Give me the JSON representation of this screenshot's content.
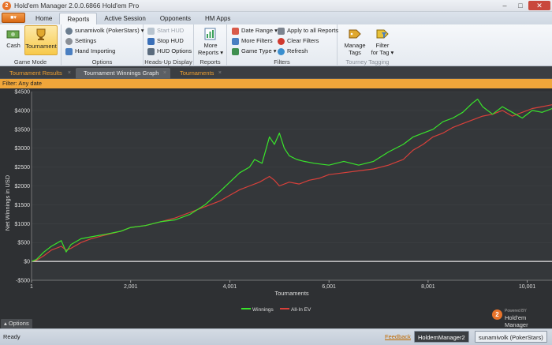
{
  "window": {
    "title": "Hold'em Manager 2.0.0.6866 Hold'em Pro",
    "app_button": "■▾"
  },
  "menu_tabs": [
    "Home",
    "Reports",
    "Active Session",
    "Opponents",
    "HM Apps"
  ],
  "active_menu_tab": "Reports",
  "ribbon": {
    "game_mode": {
      "label": "Game Mode",
      "cash": "Cash",
      "tournament": "Tournament"
    },
    "options": {
      "label": "Options",
      "player": "sunamivolk (PokerStars) ▾",
      "settings": "Settings",
      "hand_importing": "Hand Importing"
    },
    "hud": {
      "label": "Heads-Up Display",
      "start": "Start HUD",
      "stop": "Stop HUD",
      "options": "HUD Options"
    },
    "reports": {
      "label": "Reports",
      "more_line1": "More",
      "more_line2": "Reports ▾"
    },
    "filters": {
      "label": "Filters",
      "date_range": "Date Range ▾",
      "more_filters": "More Filters",
      "game_type": "Game Type ▾",
      "apply_all": "Apply to all Reports",
      "clear": "Clear Filters",
      "refresh": "Refresh"
    },
    "tourney": {
      "label": "Tourney Tagging",
      "manage_line1": "Manage",
      "manage_line2": "Tags",
      "filter_line1": "Filter",
      "filter_line2": "for Tag ▾"
    }
  },
  "doc_tabs": [
    {
      "label": "Tournament Results",
      "close": "×"
    },
    {
      "label": "Tournament Winnings Graph",
      "close": "×"
    },
    {
      "label": "Tournaments",
      "close": "×"
    }
  ],
  "active_doc_tab": "Tournament Winnings Graph",
  "filter_bar": {
    "text": "Filter:  Any date"
  },
  "options_button": "▴ Options",
  "brand": {
    "powered_by": "Powered BY",
    "name": "Hold'em Manager",
    "badge": "2"
  },
  "status": {
    "ready": "Ready",
    "feedback": "Feedback",
    "app": "HoldemManager2",
    "player": "sunamivolk (PokerStars)"
  },
  "colors": {
    "winnings": "#39e52b",
    "allin_ev": "#d9403a",
    "accent": "#f0a63a",
    "chart_bg": "#2e3033"
  },
  "chart_data": {
    "type": "line",
    "title": "",
    "xlabel": "Tournaments",
    "ylabel": "Net Winnings in USD",
    "xlim": [
      1,
      10500
    ],
    "ylim": [
      -500,
      4500
    ],
    "x_ticks": [
      1,
      2001,
      4001,
      6001,
      8001,
      10001
    ],
    "x_tick_labels": [
      "1",
      "2,001",
      "4,001",
      "6,001",
      "8,001",
      "10,001"
    ],
    "y_ticks": [
      -500,
      0,
      500,
      1000,
      1500,
      2000,
      2500,
      3000,
      3500,
      4000,
      4500
    ],
    "y_tick_labels": [
      "-$500",
      "$0",
      "$500",
      "$1000",
      "$1500",
      "$2000",
      "$2500",
      "$3000",
      "$3500",
      "$4000",
      "$4500"
    ],
    "legend_position": "bottom-center",
    "series": [
      {
        "name": "Winnings",
        "color": "#39e52b",
        "x": [
          1,
          100,
          250,
          400,
          600,
          700,
          800,
          1000,
          1200,
          1500,
          1800,
          2000,
          2300,
          2600,
          2900,
          3200,
          3500,
          3800,
          4000,
          4200,
          4400,
          4500,
          4650,
          4800,
          4900,
          5000,
          5100,
          5200,
          5350,
          5500,
          5700,
          6000,
          6300,
          6600,
          6900,
          7200,
          7500,
          7700,
          7900,
          8100,
          8300,
          8500,
          8700,
          8900,
          9000,
          9100,
          9300,
          9500,
          9700,
          9900,
          10100,
          10300,
          10500
        ],
        "y": [
          0,
          50,
          250,
          400,
          550,
          250,
          450,
          600,
          650,
          720,
          800,
          900,
          950,
          1050,
          1100,
          1250,
          1500,
          1850,
          2100,
          2350,
          2500,
          2700,
          2600,
          3300,
          3100,
          3400,
          3000,
          2800,
          2700,
          2650,
          2600,
          2550,
          2650,
          2550,
          2650,
          2900,
          3100,
          3300,
          3400,
          3500,
          3700,
          3800,
          3950,
          4200,
          4300,
          4100,
          3900,
          4100,
          3950,
          3800,
          4000,
          3950,
          4050
        ]
      },
      {
        "name": "All-In EV",
        "color": "#d9403a",
        "x": [
          1,
          100,
          250,
          400,
          600,
          700,
          800,
          1000,
          1200,
          1500,
          1800,
          2000,
          2300,
          2600,
          2900,
          3200,
          3500,
          3800,
          4000,
          4200,
          4400,
          4600,
          4800,
          4900,
          5000,
          5200,
          5400,
          5600,
          5800,
          6000,
          6300,
          6600,
          6900,
          7200,
          7500,
          7700,
          7900,
          8100,
          8300,
          8500,
          8700,
          8900,
          9100,
          9300,
          9500,
          9700,
          9900,
          10100,
          10300,
          10500
        ],
        "y": [
          0,
          30,
          150,
          300,
          400,
          300,
          350,
          500,
          600,
          700,
          800,
          900,
          950,
          1050,
          1150,
          1300,
          1450,
          1600,
          1750,
          1900,
          2000,
          2100,
          2250,
          2150,
          2000,
          2100,
          2050,
          2150,
          2200,
          2300,
          2350,
          2400,
          2450,
          2550,
          2700,
          2950,
          3100,
          3300,
          3400,
          3550,
          3650,
          3750,
          3850,
          3900,
          4000,
          3850,
          3950,
          4050,
          4100,
          4150
        ]
      }
    ]
  }
}
